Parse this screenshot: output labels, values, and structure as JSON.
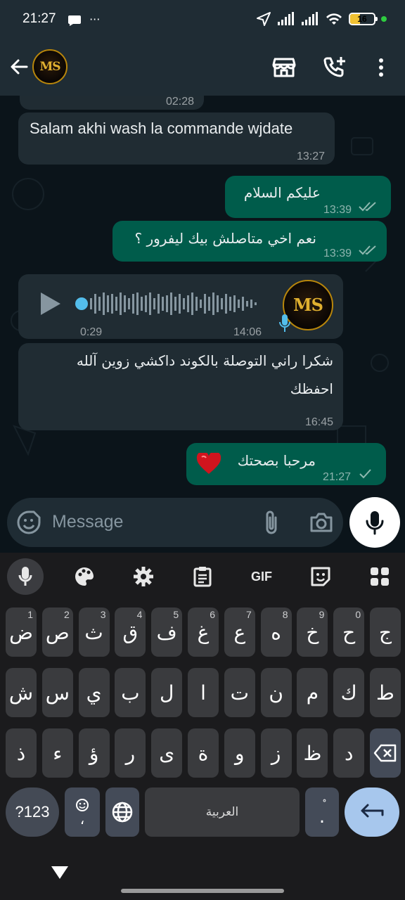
{
  "status_bar": {
    "time": "21:27",
    "extra": "···",
    "battery": "16"
  },
  "header": {
    "avatar_text": "MS"
  },
  "chat": {
    "prev_time": "02:28",
    "messages": [
      {
        "dir": "in",
        "text": "Salam akhi wash la commande wjdate",
        "time": "13:27"
      },
      {
        "dir": "out",
        "text": "عليكم السلام",
        "time": "13:39"
      },
      {
        "dir": "out",
        "text": "نعم اخي متاصلش بيك ليفرور ؟",
        "time": "13:39"
      },
      {
        "dir": "in",
        "type": "voice",
        "duration": "0:29",
        "time": "14:06"
      },
      {
        "dir": "in",
        "text_line1": "شكرا راني التوصلة بالكوند داكشي زوين آلله",
        "text_line2": "احفظك",
        "time": "16:45"
      },
      {
        "dir": "out",
        "text": "مرحبا بصحتك",
        "time": "21:27"
      }
    ]
  },
  "input": {
    "placeholder": "Message"
  },
  "keyboard": {
    "toolbar_gif": "GIF",
    "row1": [
      {
        "k": "ض",
        "h": "1"
      },
      {
        "k": "ص",
        "h": "2"
      },
      {
        "k": "ث",
        "h": "3"
      },
      {
        "k": "ق",
        "h": "4"
      },
      {
        "k": "ف",
        "h": "5"
      },
      {
        "k": "غ",
        "h": "6"
      },
      {
        "k": "ع",
        "h": "7"
      },
      {
        "k": "ه",
        "h": "8"
      },
      {
        "k": "خ",
        "h": "9"
      },
      {
        "k": "ح",
        "h": "0"
      },
      {
        "k": "ج",
        "h": ""
      }
    ],
    "row2": [
      "ش",
      "س",
      "ي",
      "ب",
      "ل",
      "ا",
      "ت",
      "ن",
      "م",
      "ك",
      "ط"
    ],
    "row3": [
      "ذ",
      "ء",
      "ؤ",
      "ر",
      "ى",
      "ة",
      "و",
      "ز",
      "ظ",
      "د"
    ],
    "symbols": "?123",
    "emoji_comma": "،",
    "space": "العربية",
    "period_key": "."
  }
}
